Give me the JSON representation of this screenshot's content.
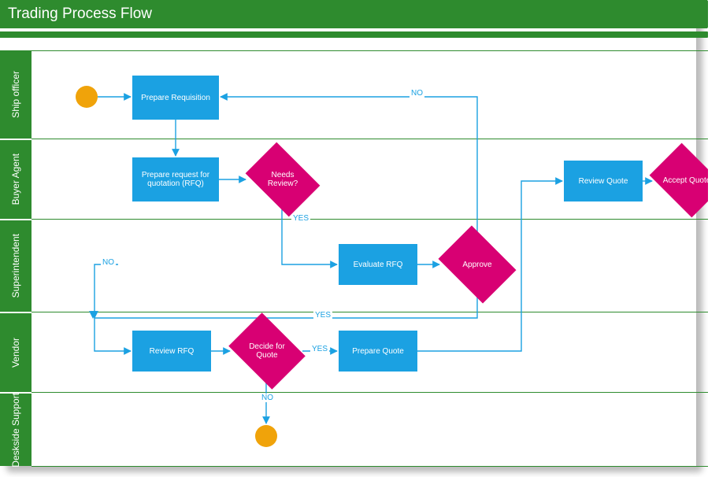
{
  "title": "Trading Process Flow",
  "colors": {
    "lane_header": "#2E8B2E",
    "process": "#1BA1E2",
    "decision": "#D80073",
    "terminator": "#F0A30A",
    "connector": "#1BA1E2"
  },
  "lanes": [
    {
      "id": "ship-officer",
      "label": "Ship officer"
    },
    {
      "id": "buyer-agent",
      "label": "Buyer Agent"
    },
    {
      "id": "superintendent",
      "label": "Superintendent"
    },
    {
      "id": "vendor",
      "label": "Vendor"
    },
    {
      "id": "deskside-support",
      "label": "Deskside Support"
    }
  ],
  "nodes": {
    "prepare_requisition": "Prepare Requisition",
    "prepare_rfq": "Prepare request for quotation (RFQ)",
    "needs_review": "Needs Review?",
    "evaluate_rfq": "Evaluate RFQ",
    "approve": "Approve",
    "review_rfq": "Review RFQ",
    "decide_quote": "Decide for Quote",
    "prepare_quote": "Prepare Quote",
    "review_quote": "Review Quote",
    "accept_quote": "Accept Quote"
  },
  "labels": {
    "yes": "YES",
    "no": "NO"
  },
  "chart_data": {
    "type": "swimlane-flowchart",
    "title": "Trading Process Flow",
    "lanes": [
      "Ship officer",
      "Buyer Agent",
      "Superintendent",
      "Vendor",
      "Deskside Support"
    ],
    "shapes": [
      {
        "id": "start",
        "type": "start",
        "lane": "Ship officer",
        "label": ""
      },
      {
        "id": "req",
        "type": "process",
        "lane": "Ship officer",
        "label": "Prepare Requisition"
      },
      {
        "id": "rfq",
        "type": "process",
        "lane": "Buyer Agent",
        "label": "Prepare request for quotation (RFQ)"
      },
      {
        "id": "needrev",
        "type": "decision",
        "lane": "Buyer Agent",
        "label": "Needs Review?"
      },
      {
        "id": "eval",
        "type": "process",
        "lane": "Superintendent",
        "label": "Evaluate RFQ"
      },
      {
        "id": "approve",
        "type": "decision",
        "lane": "Superintendent",
        "label": "Approve"
      },
      {
        "id": "revrfq",
        "type": "process",
        "lane": "Vendor",
        "label": "Review RFQ"
      },
      {
        "id": "decide",
        "type": "decision",
        "lane": "Vendor",
        "label": "Decide for Quote"
      },
      {
        "id": "prepq",
        "type": "process",
        "lane": "Vendor",
        "label": "Prepare Quote"
      },
      {
        "id": "revq",
        "type": "process",
        "lane": "Buyer Agent",
        "label": "Review Quote"
      },
      {
        "id": "accq",
        "type": "decision",
        "lane": "Buyer Agent",
        "label": "Accept Quote"
      },
      {
        "id": "end",
        "type": "end",
        "lane": "Deskside Support",
        "label": ""
      }
    ],
    "edges": [
      {
        "from": "start",
        "to": "req",
        "label": ""
      },
      {
        "from": "req",
        "to": "rfq",
        "label": ""
      },
      {
        "from": "rfq",
        "to": "needrev",
        "label": ""
      },
      {
        "from": "needrev",
        "to": "eval",
        "label": "YES"
      },
      {
        "from": "eval",
        "to": "approve",
        "label": ""
      },
      {
        "from": "approve",
        "to": "req",
        "label": "NO"
      },
      {
        "from": "approve",
        "to": "revrfq",
        "label": "YES"
      },
      {
        "from": "revrfq",
        "to": "decide",
        "label": ""
      },
      {
        "from": "decide",
        "to": "prepq",
        "label": "YES"
      },
      {
        "from": "decide",
        "to": "end",
        "label": "NO"
      },
      {
        "from": "prepq",
        "to": "revq",
        "label": ""
      },
      {
        "from": "revq",
        "to": "accq",
        "label": ""
      }
    ]
  }
}
